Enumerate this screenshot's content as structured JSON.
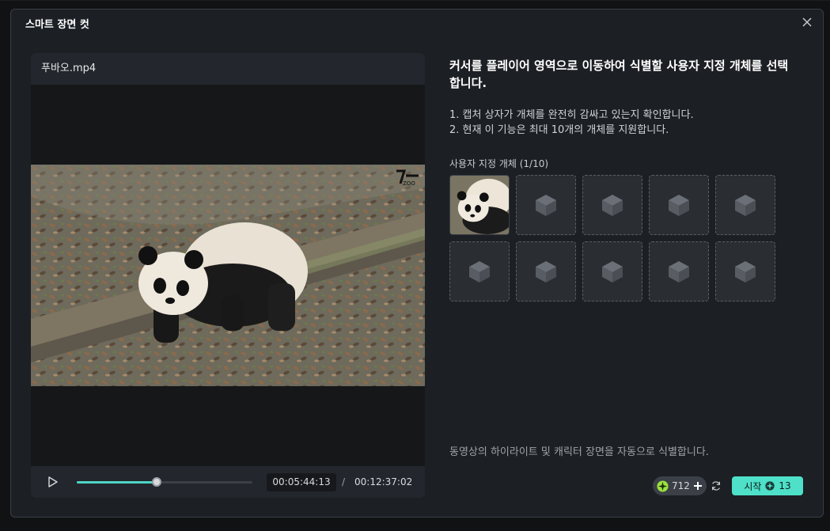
{
  "dialog": {
    "title": "스마트 장면 컷"
  },
  "player": {
    "filename": "푸바오.mp4",
    "current_time": "00:05:44:13",
    "separator": "/",
    "total_time": "00:12:37:02",
    "progress": 0.455
  },
  "instructions": {
    "heading": "커서를 플레이어 영역으로 이동하여 식별할 사용자 지정 개체를 선택합니다.",
    "hint1": "1. 캡처 상자가 개체를 완전히 감싸고 있는지 확인합니다.",
    "hint2": "2. 현재 이 기능은 최대 10개의 개체를 지원합니다."
  },
  "objects": {
    "label": "사용자 지정 개체 (1/10)",
    "slots": [
      {
        "filled": true
      },
      {
        "filled": false
      },
      {
        "filled": false
      },
      {
        "filled": false
      },
      {
        "filled": false
      },
      {
        "filled": false
      },
      {
        "filled": false
      },
      {
        "filled": false
      },
      {
        "filled": false
      },
      {
        "filled": false
      }
    ]
  },
  "footer": {
    "description": "동영상의 하이라이트 및 캐릭터 장면을 자동으로 식별합니다.",
    "credits": "712",
    "start_label": "시작",
    "start_cost": "13"
  },
  "colors": {
    "accent": "#4ee0c8",
    "progress": "#4ed6c4"
  },
  "icons": [
    "close-icon",
    "play-icon",
    "cube-icon",
    "credit-icon",
    "plus-icon",
    "refresh-icon"
  ]
}
